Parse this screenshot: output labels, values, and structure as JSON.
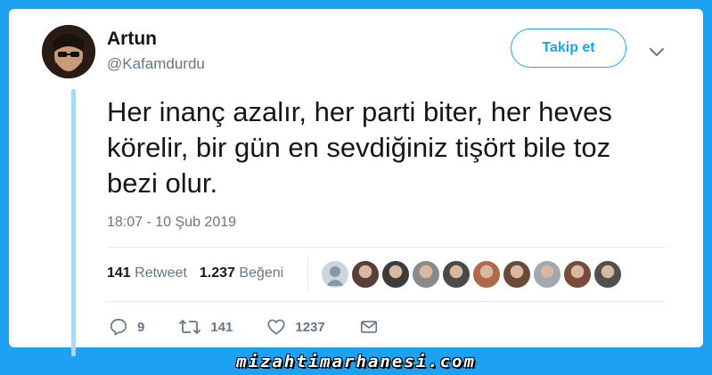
{
  "tweet": {
    "author_name": "Artun",
    "author_handle": "@Kafamdurdu",
    "follow_label": "Takip et",
    "text": "Her inanç azalır, her parti biter, her heves körelir, bir gün en sevdiğiniz tişört bile toz bezi olur.",
    "timestamp": "18:07 - 10 Şub 2019"
  },
  "stats": {
    "retweet_count": "141",
    "retweet_label": "Retweet",
    "like_count": "1.237",
    "like_label": "Beğeni"
  },
  "actions": {
    "reply_count": "9",
    "retweet_count": "141",
    "like_count": "1237"
  },
  "likers": [
    {
      "name": "liker-avatar-default",
      "color": "#8899a6"
    },
    {
      "name": "liker-avatar-2",
      "color": "#5a3e3a"
    },
    {
      "name": "liker-avatar-3",
      "color": "#3c3c3c"
    },
    {
      "name": "liker-avatar-4",
      "color": "#8a8a8a"
    },
    {
      "name": "liker-avatar-5",
      "color": "#4a4a4a"
    },
    {
      "name": "liker-avatar-6",
      "color": "#b06a4a"
    },
    {
      "name": "liker-avatar-7",
      "color": "#6b4a3a"
    },
    {
      "name": "liker-avatar-8",
      "color": "#a0a8b0"
    },
    {
      "name": "liker-avatar-9",
      "color": "#7a4a3a"
    },
    {
      "name": "liker-avatar-10",
      "color": "#505050"
    }
  ],
  "watermark": "mizahtimarhanesi.com",
  "colors": {
    "background": "#1da1f2",
    "accent": "#1da1f2",
    "thread_line": "#a9d7f6",
    "muted_text": "#657786"
  }
}
